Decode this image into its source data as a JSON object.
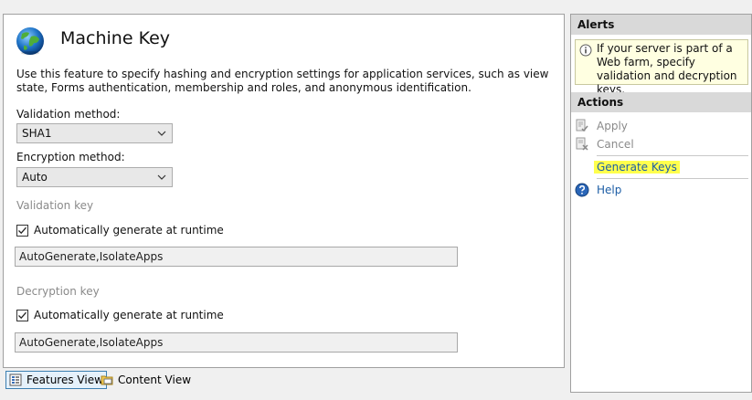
{
  "page": {
    "title": "Machine Key",
    "description": "Use this feature to specify hashing and encryption settings for application services, such as view state, Forms authentication, membership and roles, and anonymous identification."
  },
  "validation": {
    "method_label": "Validation method:",
    "method_value": "SHA1",
    "key_label": "Validation key",
    "auto_label": "Automatically generate at runtime",
    "auto_checked": true,
    "key_value": "AutoGenerate,IsolateApps"
  },
  "encryption": {
    "method_label": "Encryption method:",
    "method_value": "Auto"
  },
  "decryption": {
    "key_label": "Decryption key",
    "auto_label": "Automatically generate at runtime",
    "auto_checked": true,
    "key_value": "AutoGenerate,IsolateApps"
  },
  "bottom_bar": {
    "features_view": "Features View",
    "content_view": "Content View"
  },
  "alerts": {
    "header": "Alerts",
    "message": "If your server is part of a Web farm, specify validation and decryption keys."
  },
  "actions": {
    "header": "Actions",
    "apply": "Apply",
    "cancel": "Cancel",
    "generate_keys": "Generate Keys",
    "help": "Help"
  },
  "colors": {
    "link": "#1c5da6",
    "highlight": "#ffff4d",
    "alert_bg": "#ffffe1",
    "header_bg": "#d9d9d9"
  }
}
